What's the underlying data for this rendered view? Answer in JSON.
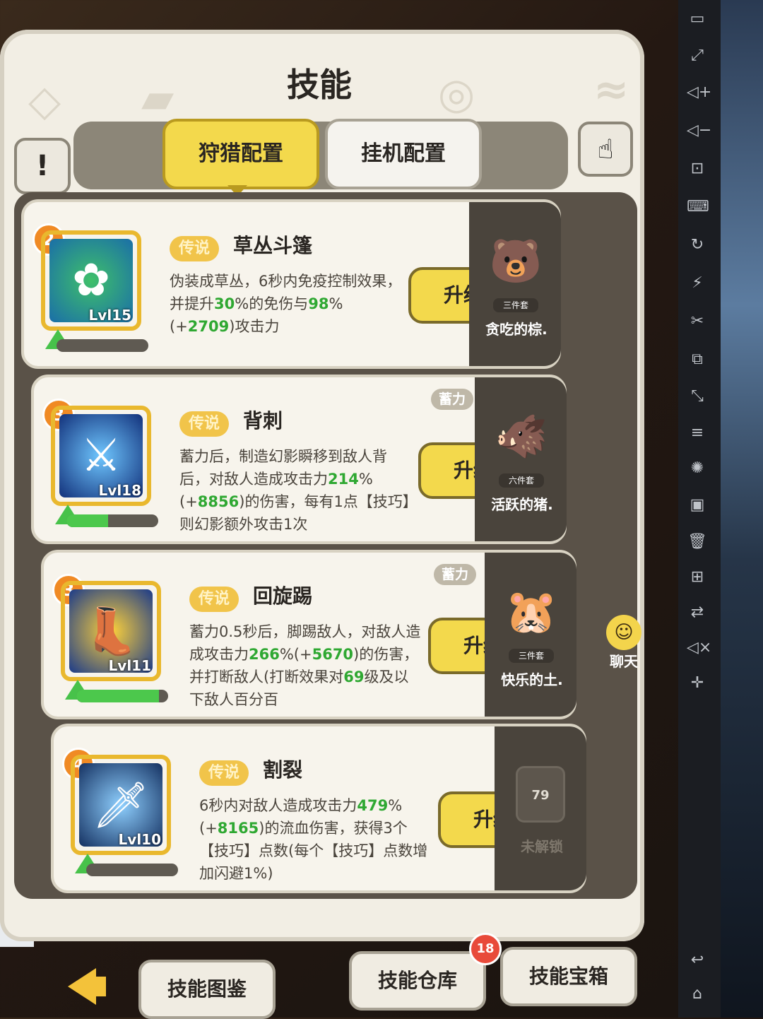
{
  "panel": {
    "title": "技能"
  },
  "tabs": [
    {
      "label": "狩猎配置",
      "active": true
    },
    {
      "label": "挂机配置",
      "active": false
    }
  ],
  "header": {
    "info_button": "!",
    "hand_icon": "tap-hand-icon"
  },
  "skills": [
    {
      "slot": "2",
      "rarity": "传说",
      "name": "草丛斗篷",
      "level": "Lvl15",
      "order": "1st",
      "charge": "",
      "desc_parts": [
        {
          "t": "伪装成草丛，6秒内免疫控制效果，并提升",
          "h": false
        },
        {
          "t": "30",
          "h": true
        },
        {
          "t": "%的免伤与",
          "h": false
        },
        {
          "t": "98",
          "h": true
        },
        {
          "t": "%(+",
          "h": false
        },
        {
          "t": "2709",
          "h": true
        },
        {
          "t": ")攻击力",
          "h": false
        }
      ],
      "upgrade": "升级",
      "exp": 0.0,
      "pet": {
        "name": "贪吃的棕.",
        "set": "三件套"
      }
    },
    {
      "slot": "3",
      "rarity": "传说",
      "name": "背刺",
      "level": "Lvl18",
      "order": "2nd",
      "charge": "蓄力",
      "desc_parts": [
        {
          "t": "蓄力后，制造幻影瞬移到敌人背后，对敌人造成攻击力",
          "h": false
        },
        {
          "t": "214",
          "h": true
        },
        {
          "t": "%(+",
          "h": false
        },
        {
          "t": "8856",
          "h": true
        },
        {
          "t": ")的伤害，每有1点【技巧】则幻影额外攻击1次",
          "h": false
        }
      ],
      "upgrade": "升级",
      "exp": 0.45,
      "pet": {
        "name": "活跃的猪.",
        "set": "六件套"
      }
    },
    {
      "slot": "3",
      "rarity": "传说",
      "name": "回旋踢",
      "level": "Lvl11",
      "order": "3rd",
      "charge": "蓄力",
      "desc_parts": [
        {
          "t": "蓄力0.5秒后，脚踢敌人，对敌人造成攻击力",
          "h": false
        },
        {
          "t": "266",
          "h": true
        },
        {
          "t": "%(+",
          "h": false
        },
        {
          "t": "5670",
          "h": true
        },
        {
          "t": ")的伤害，并打断敌人(打断效果对",
          "h": false
        },
        {
          "t": "69",
          "h": true
        },
        {
          "t": "级及以下敌人百分百",
          "h": false
        }
      ],
      "upgrade": "升级",
      "exp": 0.9,
      "pet": {
        "name": "快乐的土.",
        "set": "三件套"
      }
    },
    {
      "slot": "4",
      "rarity": "传说",
      "name": "割裂",
      "level": "Lvl10",
      "order": "4th",
      "charge": "",
      "desc_parts": [
        {
          "t": "6秒内对敌人造成攻击力",
          "h": false
        },
        {
          "t": "479",
          "h": true
        },
        {
          "t": "%(+",
          "h": false
        },
        {
          "t": "8165",
          "h": true
        },
        {
          "t": ")的流血伤害，获得3个【技巧】点数(每个【技巧】点数增加闪避1%)",
          "h": false
        }
      ],
      "upgrade": "升级",
      "exp": 0.0,
      "lock": {
        "level": "79",
        "label": "未解锁"
      }
    }
  ],
  "chat": {
    "label": "聊天"
  },
  "bottom": {
    "catalog": "技能图鉴",
    "warehouse": "技能仓库",
    "warehouse_count": "18",
    "chest": "技能宝箱"
  },
  "colors": {
    "accent_yellow": "#f3d94c",
    "highlight_green": "#2fa832",
    "badge_red": "#e84a3a",
    "slot_orange": "#f08a24"
  }
}
